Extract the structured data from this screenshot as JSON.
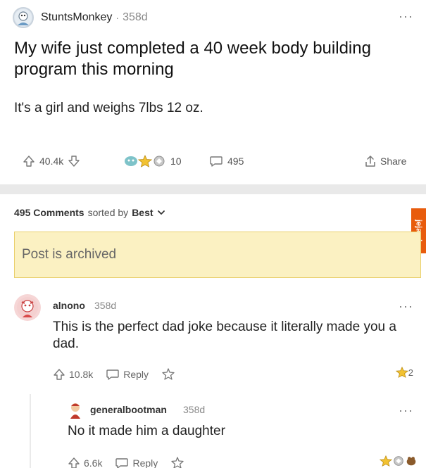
{
  "post": {
    "author": "StuntsMonkey",
    "separator_dot": "·",
    "age": "358d",
    "more_label": "···",
    "title": "My wife just completed a 40 week body building program this morning",
    "body": "It's a girl and weighs 7lbs 12 oz.",
    "score": "40.4k",
    "awards_count": "10",
    "comments_count": "495",
    "share_label": "Share"
  },
  "sort_bar": {
    "count_label": "495 Comments",
    "sorted_by": "sorted by",
    "sort_value": "Best"
  },
  "watermark": "jeja.pl",
  "archived_notice": "Post is archived",
  "comments": [
    {
      "author": "alnono",
      "age": "358d",
      "text": "This is the perfect dad joke because it literally made you a dad.",
      "score": "10.8k",
      "reply_label": "Reply",
      "award_count": "2",
      "more_label": "···"
    },
    {
      "author": "generalbootman",
      "age": "358d",
      "text": "No it made him a daughter",
      "score": "6.6k",
      "reply_label": "Reply",
      "more_label": "···"
    }
  ],
  "icons": [
    "avatar-icon",
    "upvote-icon",
    "downvote-icon",
    "award-icon",
    "comment-icon",
    "share-icon",
    "reply-icon",
    "chevron-down-icon",
    "more-icon"
  ],
  "colors": {
    "archived_bg": "#fbf1c2",
    "archived_border": "#e9cf6b",
    "separator": "#e9e9e9",
    "watermark_bg": "#e85c0d"
  }
}
